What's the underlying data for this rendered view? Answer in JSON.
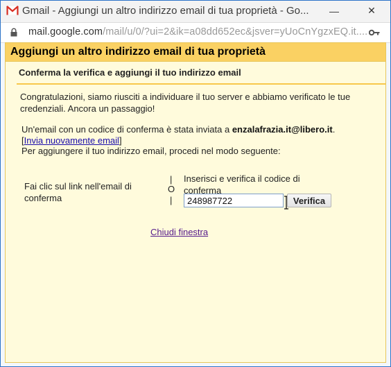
{
  "window": {
    "title": "Gmail - Aggiungi un altro indirizzo email di tua proprietà - Go...",
    "minimize_label": "—",
    "close_label": "✕"
  },
  "address": {
    "host": "mail.google.com",
    "path": "/mail/u/0/?ui=2&ik=a08dd652ec&jsver=yUoCnYgzxEQ.it...."
  },
  "dialog": {
    "header": "Aggiungi un altro indirizzo email di tua proprietà",
    "subheader": "Conferma la verifica e aggiungi il tuo indirizzo email",
    "congrats": "Congratulazioni, siamo riusciti a individuare il tuo server e abbiamo verificato le tue credenziali. Ancora un passaggio!",
    "sent_prefix": "Un'email con un codice di conferma è stata inviata a ",
    "email": "enzalafrazia.it@libero.it",
    "sent_suffix": ".",
    "resend_open": "[",
    "resend_link": "Invia nuovamente email",
    "resend_close": "]",
    "proceed": "Per aggiungere il tuo indirizzo email, procedi nel modo seguente:",
    "option_click": "Fai clic sul link nell'email di conferma",
    "or_bar_top": "|",
    "or_label": "O",
    "or_bar_bottom": "|",
    "option_code": "Inserisci e verifica il codice di conferma",
    "code_value": "248987722",
    "verify_label": "Verifica",
    "close_window": "Chiudi finestra"
  },
  "colors": {
    "header_bg": "#fad163",
    "content_bg": "#fffbdc",
    "link": "#1a0dab",
    "visited_link": "#551a8b"
  }
}
